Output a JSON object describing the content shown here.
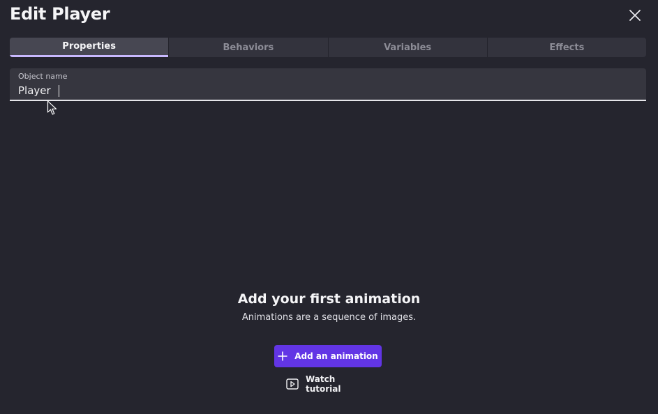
{
  "dialog": {
    "title": "Edit Player",
    "close_icon": "close-icon"
  },
  "tabs": [
    {
      "label": "Properties",
      "active": true
    },
    {
      "label": "Behaviors",
      "active": false
    },
    {
      "label": "Variables",
      "active": false
    },
    {
      "label": "Effects",
      "active": false
    }
  ],
  "object_name": {
    "label": "Object name",
    "value": "Player"
  },
  "empty_state": {
    "title": "Add your first animation",
    "subtitle": "Animations are a sequence of images.",
    "add_button": {
      "label": "Add an animation",
      "icon": "plus-icon"
    },
    "tutorial_button": {
      "label": "Watch tutorial",
      "icon": "play-icon"
    }
  },
  "colors": {
    "background": "#25252e",
    "accent": "#6235e5",
    "active_tab_underline": "#c9b9ff"
  }
}
